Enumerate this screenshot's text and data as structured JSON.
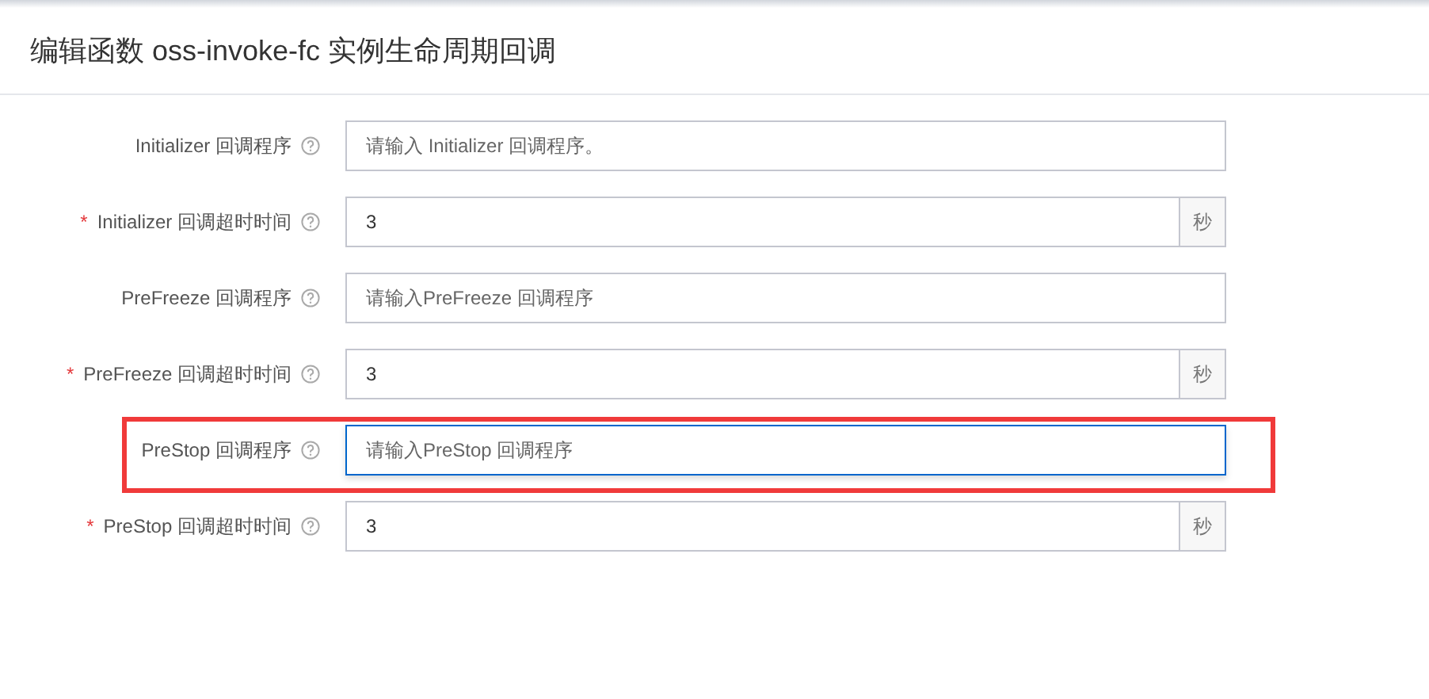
{
  "header": {
    "title": "编辑函数 oss-invoke-fc 实例生命周期回调"
  },
  "fields": [
    {
      "kind": "text",
      "label": "Initializer 回调程序",
      "placeholder": "请输入 Initializer 回调程序。",
      "focused": false,
      "highlighted": false
    },
    {
      "kind": "number",
      "required_mark": "*",
      "label": "Initializer 回调超时时间",
      "value": "3",
      "suffix": "秒",
      "focused": false,
      "highlighted": false
    },
    {
      "kind": "text",
      "label": "PreFreeze 回调程序",
      "placeholder": "请输入PreFreeze 回调程序",
      "focused": false,
      "highlighted": false
    },
    {
      "kind": "number",
      "required_mark": "*",
      "label": "PreFreeze 回调超时时间",
      "value": "3",
      "suffix": "秒",
      "focused": false,
      "highlighted": false
    },
    {
      "kind": "text",
      "label": "PreStop 回调程序",
      "placeholder": "请输入PreStop 回调程序",
      "focused": true,
      "highlighted": true
    },
    {
      "kind": "number",
      "required_mark": "*",
      "label": "PreStop 回调超时时间",
      "value": "3",
      "suffix": "秒",
      "focused": false,
      "highlighted": false
    }
  ]
}
